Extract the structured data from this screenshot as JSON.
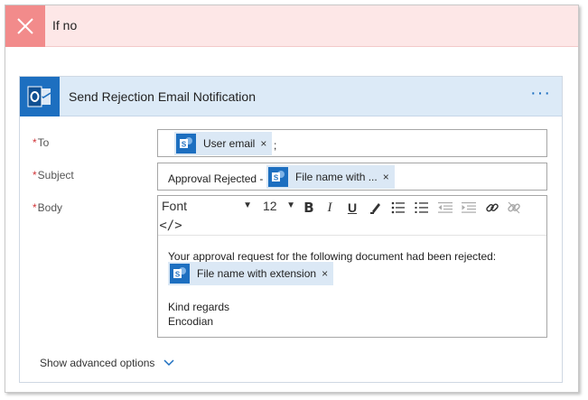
{
  "branch": {
    "title": "If no",
    "icon": "close-icon"
  },
  "action": {
    "title": "Send Rejection Email Notification",
    "icon": "outlook-icon",
    "more_label": "···"
  },
  "fields": {
    "to": {
      "label": "To",
      "required": "*",
      "token": "User email",
      "suffix": ";"
    },
    "subject": {
      "label": "Subject",
      "required": "*",
      "prefix": "Approval Rejected -",
      "token": "File name with ..."
    },
    "body": {
      "label": "Body",
      "required": "*",
      "toolbar": {
        "font": "Font",
        "size": "12",
        "code_view": "</>"
      },
      "line1": "Your approval request for the following document had been rejected:",
      "token": "File name with extension",
      "line2": "Kind regards",
      "line3": "Encodian"
    }
  },
  "advanced": {
    "label": "Show advanced options"
  },
  "token_remove_label": "×",
  "colors": {
    "accent": "#1d6fc0",
    "token_bg": "#dbe8f5",
    "no_branch_bg": "#fde7e7",
    "no_branch_icon_bg": "#f28b8b",
    "header_bg": "#dceaf7",
    "required": "#d13438"
  }
}
